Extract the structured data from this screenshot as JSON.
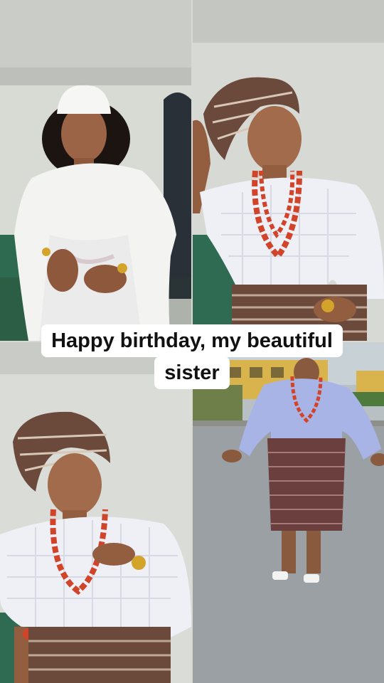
{
  "caption": {
    "line1": "Happy birthday, my beautiful",
    "line2": "sister"
  },
  "photos": [
    {
      "id": "top-left",
      "subject": "woman in white lace outfit with white cap, seated"
    },
    {
      "id": "top-right",
      "subject": "woman in gele headwrap, coral bead necklace, white lace blouse"
    },
    {
      "id": "bottom-left",
      "subject": "woman in gele headwrap with coral beads, close-up pose"
    },
    {
      "id": "bottom-right",
      "subject": "woman standing on street in blue blouse and patterned skirt"
    }
  ],
  "colors": {
    "caption_bg": "#ffffff",
    "caption_text": "#111111",
    "coral": "#d2442a",
    "lace": "#eef0f6",
    "gele": "#6b4a3c"
  }
}
